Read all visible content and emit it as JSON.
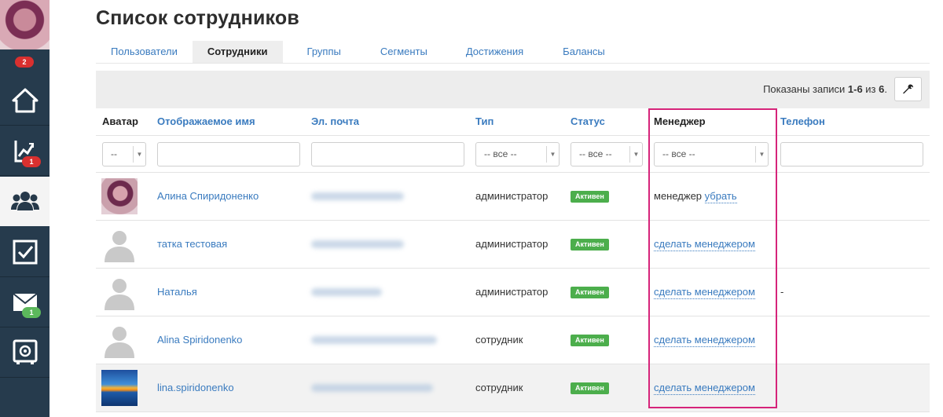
{
  "sidebar": {
    "badges": {
      "avatar_count": "2",
      "analytics": "1",
      "messages": "1"
    },
    "items": [
      {
        "name": "home",
        "icon": "home-icon"
      },
      {
        "name": "analytics",
        "icon": "chart-icon"
      },
      {
        "name": "users",
        "icon": "users-icon",
        "active": true
      },
      {
        "name": "tasks",
        "icon": "checkbox-icon"
      },
      {
        "name": "messages",
        "icon": "envelope-icon"
      },
      {
        "name": "settings",
        "icon": "safe-gear-icon"
      }
    ]
  },
  "page": {
    "title": "Список сотрудников"
  },
  "tabs": [
    "Пользователи",
    "Сотрудники",
    "Группы",
    "Сегменты",
    "Достижения",
    "Балансы"
  ],
  "active_tab": "Сотрудники",
  "toolbar": {
    "records_prefix": "Показаны записи ",
    "records_range": "1-6",
    "records_mid": " из ",
    "records_total": "6",
    "records_suffix": "."
  },
  "table": {
    "headers": {
      "avatar": "Аватар",
      "display_name": "Отображаемое имя",
      "email": "Эл. почта",
      "type": "Тип",
      "status": "Статус",
      "manager": "Менеджер",
      "phone": "Телефон"
    },
    "filters": {
      "avatar": "--",
      "type": "-- все --",
      "status": "-- все --",
      "manager": "-- все --"
    },
    "rows": [
      {
        "avatar": "photo-portrait",
        "name": "Алина Спиридоненко",
        "type": "администратор",
        "status": "Активен",
        "manager_text": "менеджер ",
        "manager_link": "убрать",
        "phone": ""
      },
      {
        "avatar": "placeholder",
        "name": "татка тестовая",
        "type": "администратор",
        "status": "Активен",
        "manager_text": "",
        "manager_link": "сделать менеджером",
        "phone": ""
      },
      {
        "avatar": "placeholder",
        "name": "Наталья",
        "type": "администратор",
        "status": "Активен",
        "manager_text": "",
        "manager_link": "сделать менеджером",
        "phone": "-"
      },
      {
        "avatar": "placeholder",
        "name": "Alina Spiridonenko",
        "type": "сотрудник",
        "status": "Активен",
        "manager_text": "",
        "manager_link": "сделать менеджером",
        "phone": ""
      },
      {
        "avatar": "photo-sunset",
        "name": "lina.spiridonenko",
        "type": "сотрудник",
        "status": "Активен",
        "manager_text": "",
        "manager_link": "сделать менеджером",
        "phone": ""
      }
    ]
  },
  "colors": {
    "sidebar": "#263b4d",
    "link": "#3a7bbf",
    "badge_red": "#d9302f",
    "badge_green": "#5cb85c",
    "status_green": "#4cae4c",
    "highlight": "#d6247a"
  }
}
